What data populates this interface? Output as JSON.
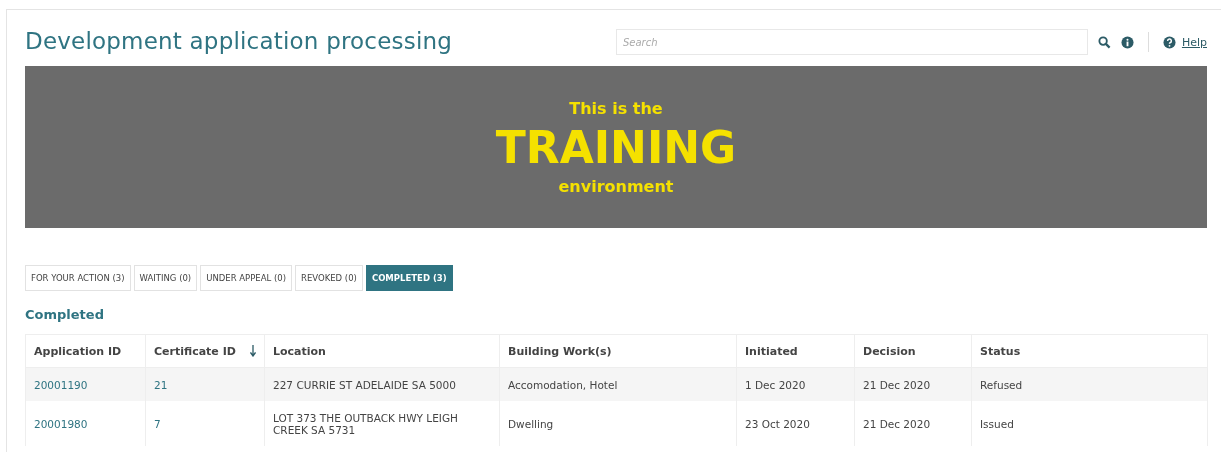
{
  "page": {
    "title": "Development application processing"
  },
  "search": {
    "placeholder": "Search"
  },
  "help": {
    "label": "Help"
  },
  "banner": {
    "line_1": "This is the",
    "line_2": "TRAINING",
    "line_3": "environment"
  },
  "tabs": [
    {
      "label": "FOR YOUR ACTION (3)",
      "selected": false
    },
    {
      "label": "WAITING (0)",
      "selected": false
    },
    {
      "label": "UNDER APPEAL (0)",
      "selected": false
    },
    {
      "label": "REVOKED (0)",
      "selected": false
    },
    {
      "label": "COMPLETED (3)",
      "selected": true
    }
  ],
  "section_title": "Completed",
  "table": {
    "columns": [
      {
        "label": "Application ID",
        "sorted": false
      },
      {
        "label": "Certificate ID",
        "sorted": true
      },
      {
        "label": "Location",
        "sorted": false
      },
      {
        "label": "Building Work(s)",
        "sorted": false
      },
      {
        "label": "Initiated",
        "sorted": false
      },
      {
        "label": "Decision",
        "sorted": false
      },
      {
        "label": "Status",
        "sorted": false
      }
    ],
    "rows": [
      [
        "20001190",
        "21",
        "227 CURRIE ST ADELAIDE SA 5000",
        "Accomodation, Hotel",
        "1 Dec 2020",
        "21 Dec 2020",
        "Refused"
      ],
      [
        "20001980",
        "7",
        "LOT 373 THE OUTBACK HWY LEIGH CREEK SA 5731",
        "Dwelling",
        "23 Oct 2020",
        "21 Dec 2020",
        "Issued"
      ]
    ]
  }
}
